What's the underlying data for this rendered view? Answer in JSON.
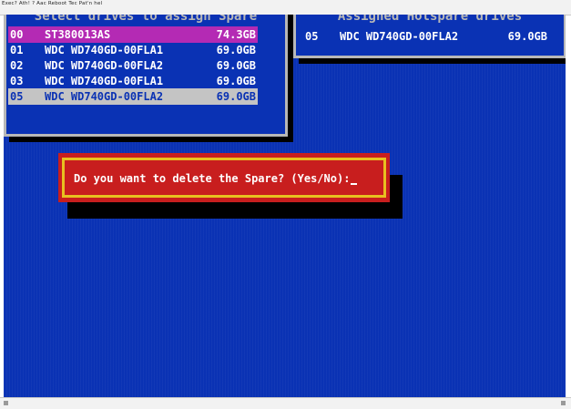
{
  "window": {
    "menubar_text": "Exec?  Ath!  ?  Aac  Reboot  Tec  Pat'n  hel"
  },
  "select_panel": {
    "title": "Select drives to assign Spare",
    "rows": [
      {
        "id": "00",
        "model": "ST380013AS",
        "size": "74.3GB",
        "state": "highlighted"
      },
      {
        "id": "01",
        "model": "WDC WD740GD-00FLA1",
        "size": "69.0GB",
        "state": "normal"
      },
      {
        "id": "02",
        "model": "WDC WD740GD-00FLA2",
        "size": "69.0GB",
        "state": "normal"
      },
      {
        "id": "03",
        "model": "WDC WD740GD-00FLA1",
        "size": "69.0GB",
        "state": "normal"
      },
      {
        "id": "05",
        "model": "WDC WD740GD-00FLA2",
        "size": "69.0GB",
        "state": "selected"
      }
    ]
  },
  "hotspare_panel": {
    "title": "Assigned Hotspare drives",
    "rows": [
      {
        "id": "05",
        "model": "WDC WD740GD-00FLA2",
        "size": "69.0GB"
      }
    ]
  },
  "dialog": {
    "prompt": "Do you want to delete the Spare? (Yes/No):"
  },
  "colors": {
    "background": "#0a32b4",
    "highlight": "#b42ab4",
    "selected": "#c4c4c4",
    "dialog": "#c81e1e",
    "dialog_border": "#e8c020"
  }
}
